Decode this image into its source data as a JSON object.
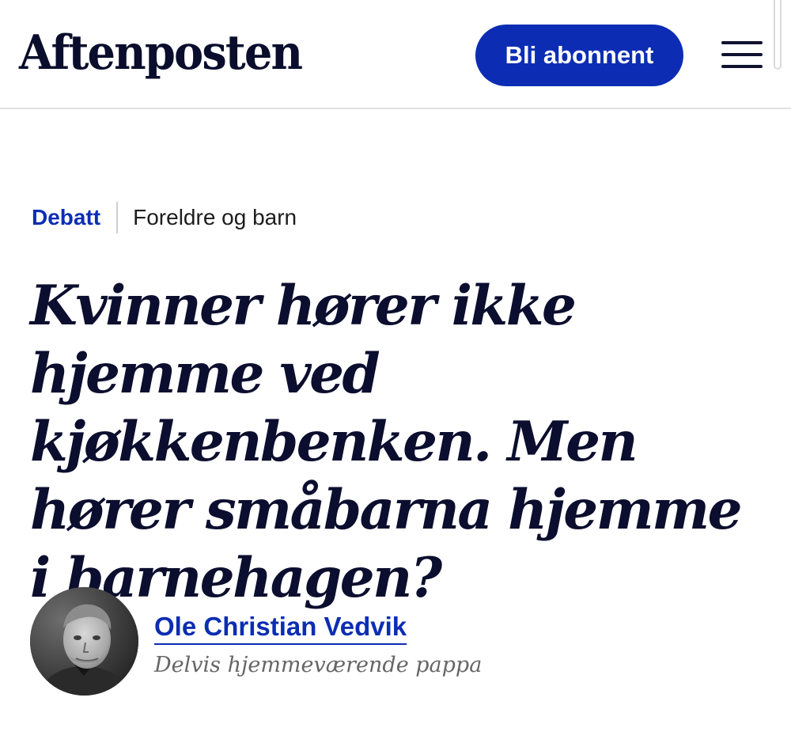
{
  "header": {
    "logo_text": "Aftenposten",
    "subscribe_label": "Bli abonnent",
    "menu_icon": "hamburger-menu-icon"
  },
  "article": {
    "section": "Debatt",
    "topic": "Foreldre og barn",
    "headline": "Kvinner hører ikke hjemme ved kjøkkenbenken. Men hører småbarna hjemme i barnehagen?",
    "author": {
      "name": "Ole Christian Vedvik",
      "role": "Delvis hjemmeværende pappa",
      "avatar_icon": "author-photo"
    }
  },
  "colors": {
    "brand_blue": "#0c2db3",
    "headline_ink": "#0b0e2e",
    "muted_text": "#666666"
  }
}
